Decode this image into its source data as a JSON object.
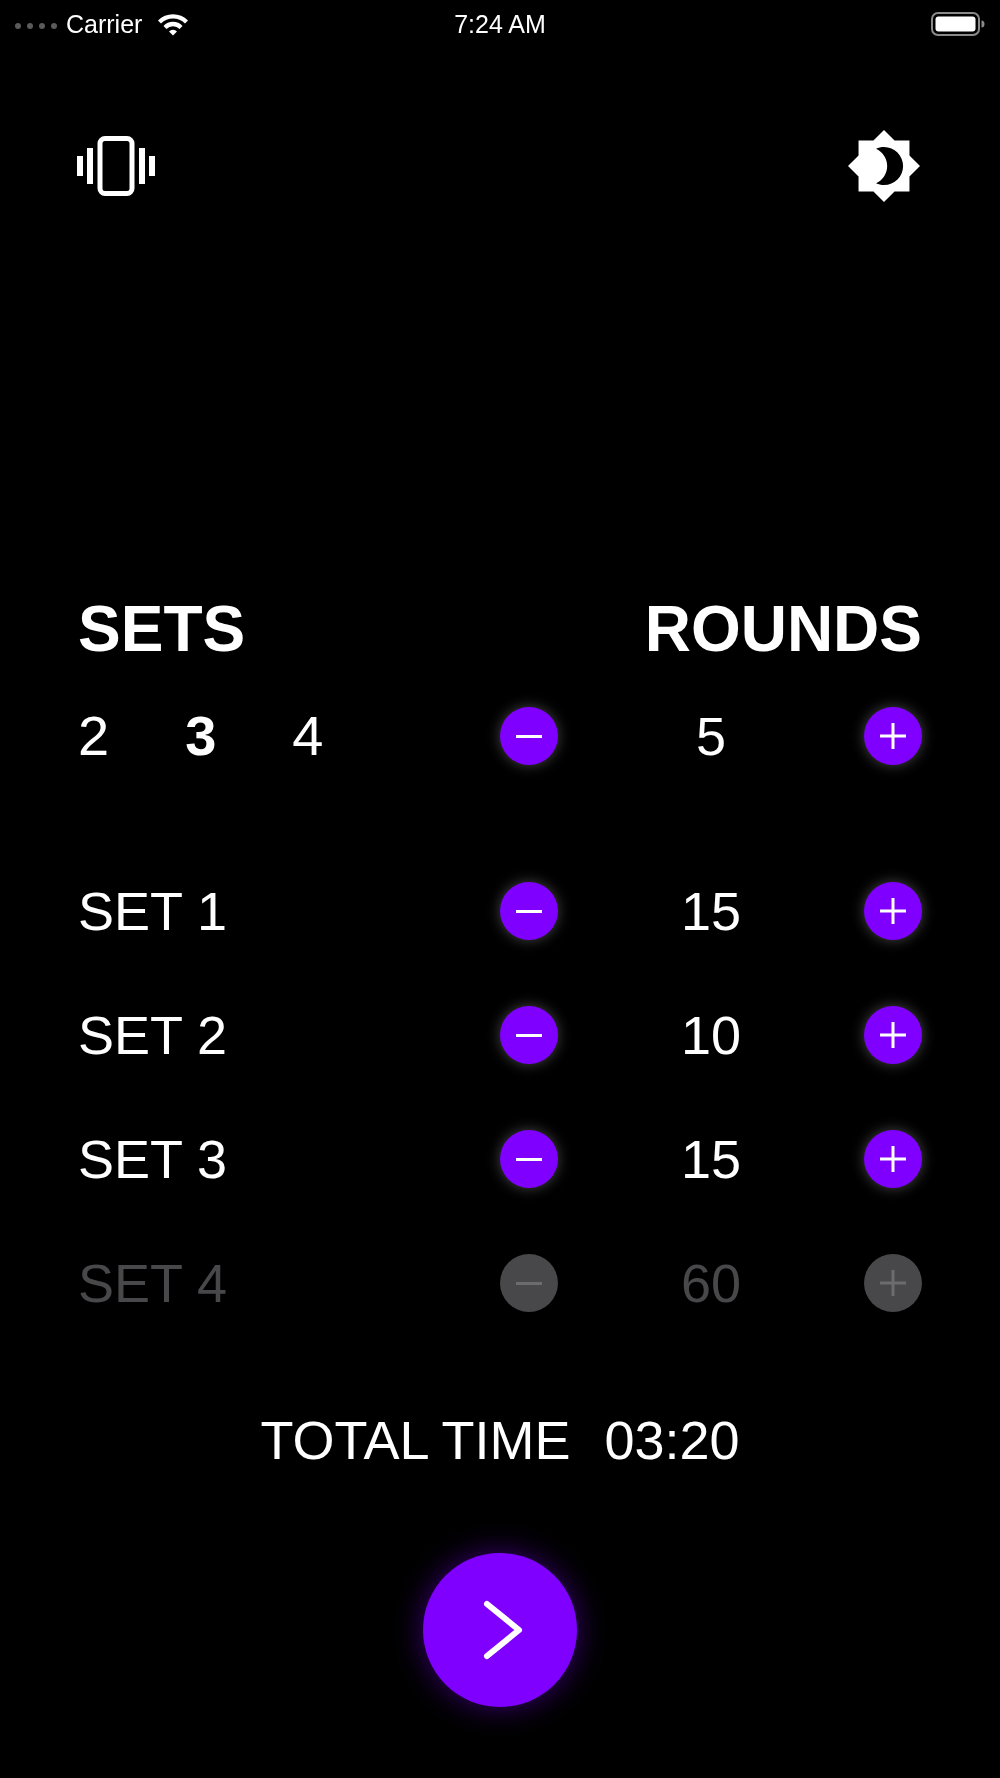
{
  "status_bar": {
    "carrier": "Carrier",
    "time": "7:24 AM"
  },
  "sets": {
    "heading": "SETS",
    "options": [
      {
        "label": "2",
        "selected": false
      },
      {
        "label": "3",
        "selected": true
      },
      {
        "label": "4",
        "selected": false
      }
    ]
  },
  "rounds": {
    "heading": "ROUNDS",
    "value": "5"
  },
  "set_rows": [
    {
      "label": "SET 1",
      "value": "15",
      "disabled": false
    },
    {
      "label": "SET 2",
      "value": "10",
      "disabled": false
    },
    {
      "label": "SET 3",
      "value": "15",
      "disabled": false
    },
    {
      "label": "SET 4",
      "value": "60",
      "disabled": true
    }
  ],
  "total_time": {
    "label": "TOTAL TIME",
    "value": "03:20"
  }
}
